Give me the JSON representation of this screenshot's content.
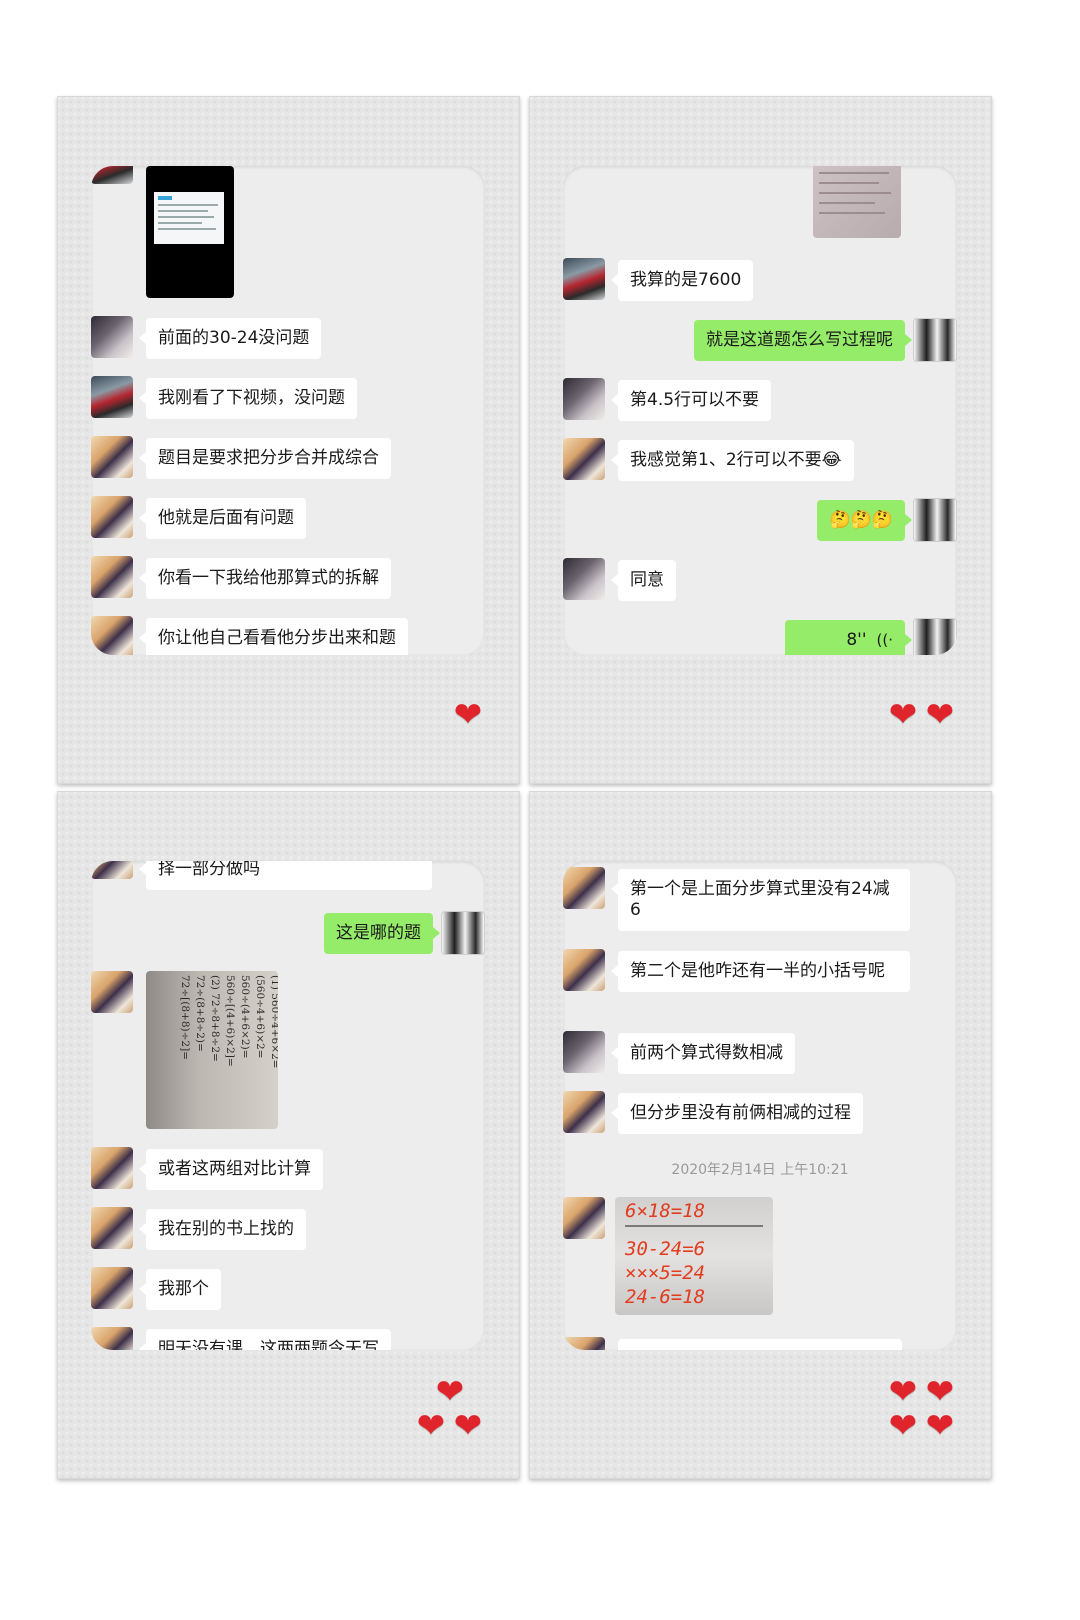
{
  "panels": [
    {
      "messages": [
        {
          "side": "left",
          "text": "前面的30-24没问题"
        },
        {
          "side": "left",
          "text": "我刚看了下视频，没问题"
        },
        {
          "side": "left",
          "text": "题目是要求把分步合并成综合"
        },
        {
          "side": "left",
          "text": "他就是后面有问题"
        },
        {
          "side": "left",
          "text": "你看一下我给他那算式的拆解"
        },
        {
          "side": "left",
          "text": "你让他自己看看他分步出来和题"
        }
      ],
      "heart_count": 1
    },
    {
      "messages": [
        {
          "side": "left",
          "text": "我算的是7600"
        },
        {
          "side": "right",
          "text": "就是这道题怎么写过程呢"
        },
        {
          "side": "left",
          "text": "第4.5行可以不要"
        },
        {
          "side": "left",
          "text": "我感觉第1、2行可以不要😂"
        },
        {
          "side": "right",
          "text": "🤔🤔🤔"
        },
        {
          "side": "left",
          "text": "同意"
        },
        {
          "side": "right",
          "text": "8''",
          "voice_icon": "((·"
        }
      ],
      "heart_count": 2
    },
    {
      "messages": [
        {
          "side": "left",
          "text": "择一部分做吗"
        },
        {
          "side": "right",
          "text": "这是哪的题"
        },
        {
          "side": "left",
          "text": "或者这两组对比计算"
        },
        {
          "side": "left",
          "text": "我在别的书上找的"
        },
        {
          "side": "left",
          "text": "我那个"
        },
        {
          "side": "left",
          "text": "明天没有课，这两两题令天写"
        }
      ],
      "worksheet_lines": [
        "(1) 560÷4+6×2=",
        "(560÷4+6)×2=",
        "560÷(4+6×2)=",
        "560÷[(4+6)×2]=",
        "(2) 72÷8+8÷2=",
        "72÷(8+8÷2)=",
        "72÷[(8+8)÷2]="
      ],
      "heart_count": 3
    },
    {
      "messages": [
        {
          "side": "left",
          "text": "第一个是上面分步算式里没有24减6"
        },
        {
          "side": "left",
          "text": "第二个是他咋还有一半的小括号呢"
        },
        {
          "side": "left",
          "text": "前两个算式得数相减"
        },
        {
          "side": "left",
          "text": "但分步里没有前俩相减的过程"
        }
      ],
      "timestamp": "2020年2月14日 上午10:21",
      "handwriting_lines": [
        "6×18=18",
        "30-24=6",
        "×××5=24",
        "24-6=18"
      ],
      "heart_count": 4
    }
  ],
  "colors": {
    "sent_bubble": "#95ec69",
    "received_bubble": "#ffffff",
    "chat_background": "#ededed",
    "heart": "#e0242b"
  }
}
